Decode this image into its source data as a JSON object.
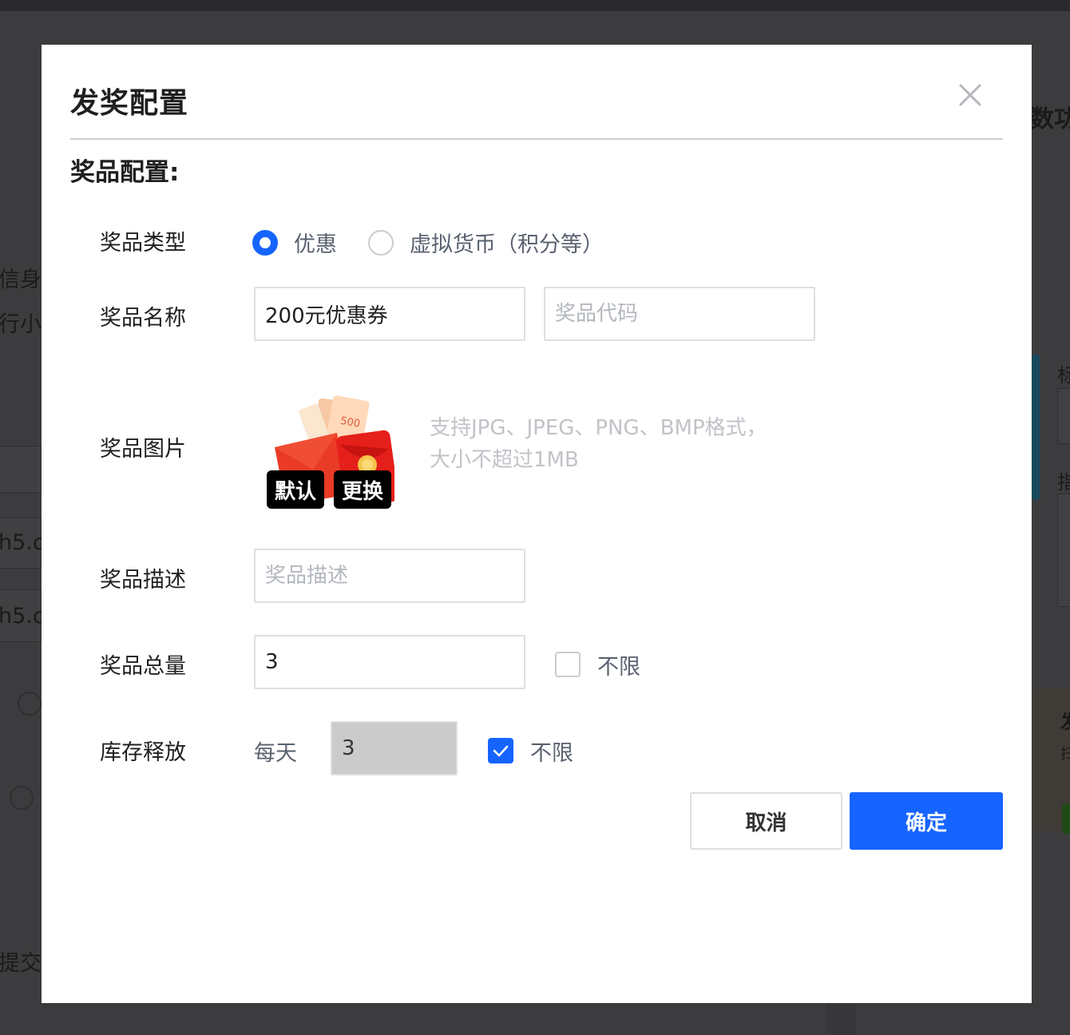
{
  "background": {
    "right_title_fragment": "数功能",
    "left_text_1": "信身份",
    "left_text_2": "行小",
    "left_text_3": "h5.c",
    "left_text_4": "h5.c",
    "left_text_5": "提交",
    "right_text_1": "标",
    "right_text_2": "指",
    "right_text_3": "发",
    "right_text_4": "扫"
  },
  "modal": {
    "title": "发奖配置",
    "close_icon": "close-icon",
    "section_title": "奖品配置:",
    "prize_type": {
      "label": "奖品类型",
      "options": [
        {
          "label": "优惠",
          "checked": true
        },
        {
          "label": "虚拟货币（积分等）",
          "checked": false
        }
      ]
    },
    "prize_name": {
      "label": "奖品名称",
      "value": "200元优惠券",
      "code_placeholder": "奖品代码"
    },
    "prize_image": {
      "label": "奖品图片",
      "default_button": "默认",
      "change_button": "更换",
      "hint": "支持JPG、JPEG、PNG、BMP格式，大小不超过1MB"
    },
    "prize_desc": {
      "label": "奖品描述",
      "placeholder": "奖品描述"
    },
    "prize_total": {
      "label": "奖品总量",
      "value": "3",
      "unlimited_label": "不限",
      "unlimited_checked": false
    },
    "stock_release": {
      "label": "库存释放",
      "prefix": "每天",
      "value": "3",
      "unlimited_label": "不限",
      "unlimited_checked": true
    },
    "buttons": {
      "cancel": "取消",
      "confirm": "确定"
    }
  },
  "colors": {
    "primary": "#1664ff",
    "overlay": "#3c3c3e"
  }
}
